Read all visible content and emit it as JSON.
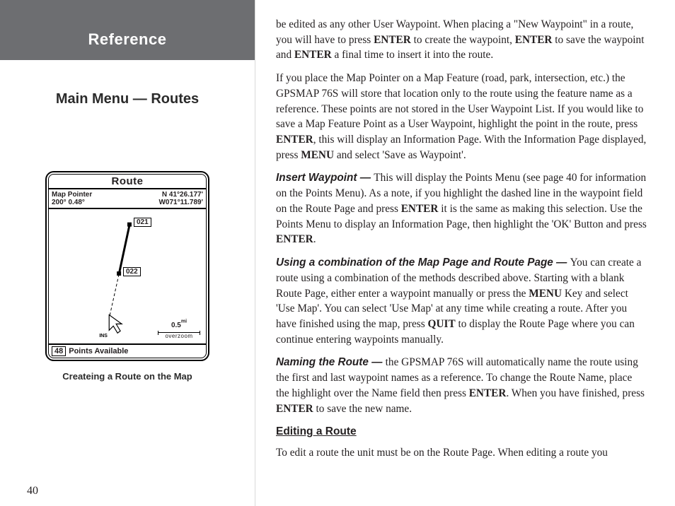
{
  "sidebar": {
    "reference": "Reference",
    "subtitle": "Main Menu — Routes",
    "caption": "Createing a Route on the Map",
    "page_number": "40"
  },
  "device": {
    "title": "Route",
    "pointer_label": "Map Pointer",
    "pointer_info": "200°  0.48°",
    "lat": "N  41°26.177'",
    "lon": "W071°11.789'",
    "wp1": "021",
    "wp2": "022",
    "scale": "0.5",
    "scale_unit": "mi",
    "overzoom": "overzoom",
    "points_num": "48",
    "points_text": "Points Available",
    "ins": "INS"
  },
  "body": {
    "p1_a": "be edited as any other User Waypoint.  When placing a \"New Waypoint\" in a route, you will have to press ",
    "p1_b": "ENTER",
    "p1_c": " to create the waypoint, ",
    "p1_d": "ENTER",
    "p1_e": " to save the waypoint and ",
    "p1_f": "ENTER",
    "p1_g": " a final time to insert it into the route.",
    "p2_a": "If you place the Map Pointer on a Map Feature (road, park, intersection, etc.) the GPSMAP 76S will store that location only to the route using the feature name as a reference. These points are not stored in the User Waypoint List. If you would like to save a Map Feature Point as a User Waypoint, highlight the point in the route, press ",
    "p2_b": "ENTER",
    "p2_c": ", this will display an Information Page. With the Information Page displayed, press ",
    "p2_d": "MENU",
    "p2_e": " and select 'Save as Waypoint'.",
    "p3_lead": "Insert Waypoint — ",
    "p3_a": "This will display the Points Menu (see page 40 for infor­mation on the Points Menu).  As a note, if you highlight the dashed line in the waypoint field on the Route Page and press ",
    "p3_b": "ENTER",
    "p3_c": " it is the same as making this selection. Use the Points Menu to display an Information Page, then highlight the 'OK' Button and press ",
    "p3_d": "ENTER",
    "p3_e": ".",
    "p4_lead": "Using a combination of the Map Page and Route Page — ",
    "p4_a": " You can create a route using a combination of the methods described above.  Starting with a blank Route Page, either enter a waypoint manually or press the ",
    "p4_b": "MENU",
    "p4_c": " Key and select 'Use Map'.  You can select 'Use Map' at any time while creating a route.  After you have finished using the map, press ",
    "p4_d": "QUIT",
    "p4_e": " to display the Route Page where you can continue entering waypoints manually.",
    "p5_lead": "Naming the Route — ",
    "p5_a": "the GPSMAP 76S will automatically name the route using the first and last waypoint names as a reference.  To change the Route Name, place the highlight over the Name field then press ",
    "p5_b": "ENTER",
    "p5_c": ".  When you have finished, press ",
    "p5_d": "ENTER",
    "p5_e": " to save the new name.",
    "h1": "Editing a Route",
    "p6": "To edit a route the unit must be on the Route Page.  When editing a route you"
  }
}
